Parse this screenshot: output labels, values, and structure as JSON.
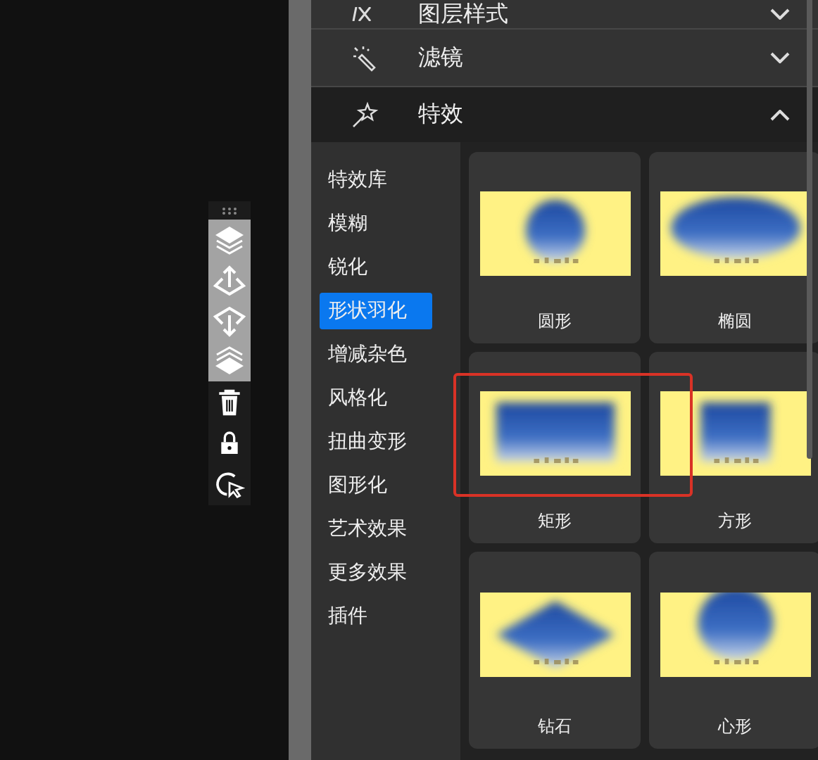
{
  "toolbar": {
    "items": [
      {
        "kind": "layer-up"
      },
      {
        "kind": "move-up"
      },
      {
        "kind": "move-down"
      },
      {
        "kind": "layer-down"
      },
      {
        "kind": "trash"
      },
      {
        "kind": "lock"
      },
      {
        "kind": "select"
      }
    ]
  },
  "sections": [
    {
      "title": "图层样式",
      "kind": "fx",
      "expanded": false
    },
    {
      "title": "滤镜",
      "kind": "wand",
      "expanded": false
    },
    {
      "title": "特效",
      "kind": "star-wand",
      "expanded": true
    }
  ],
  "categories": [
    {
      "label": "特效库",
      "selected": false
    },
    {
      "label": "模糊",
      "selected": false
    },
    {
      "label": "锐化",
      "selected": false
    },
    {
      "label": "形状羽化",
      "selected": true
    },
    {
      "label": "增减杂色",
      "selected": false
    },
    {
      "label": "风格化",
      "selected": false
    },
    {
      "label": "扭曲变形",
      "selected": false
    },
    {
      "label": "图形化",
      "selected": false
    },
    {
      "label": "艺术效果",
      "selected": false
    },
    {
      "label": "更多效果",
      "selected": false
    },
    {
      "label": "插件",
      "selected": false
    }
  ],
  "effects": [
    {
      "label": "圆形",
      "kind": "circle",
      "highlighted": false
    },
    {
      "label": "椭圆",
      "kind": "ellipse",
      "highlighted": false
    },
    {
      "label": "矩形",
      "kind": "rect",
      "highlighted": true
    },
    {
      "label": "方形",
      "kind": "square",
      "highlighted": false
    },
    {
      "label": "钻石",
      "kind": "diamond",
      "highlighted": false
    },
    {
      "label": "心形",
      "kind": "heart",
      "highlighted": false
    }
  ]
}
